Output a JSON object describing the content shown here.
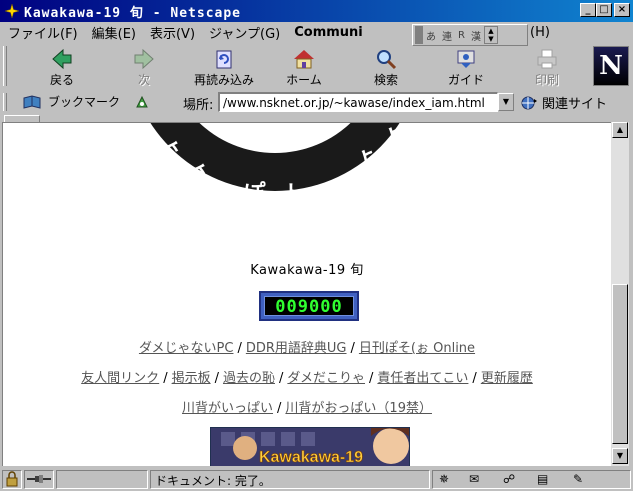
{
  "window": {
    "title": "Kawakawa-19 旬 - Netscape"
  },
  "menu": {
    "items": [
      "ファイル(F)",
      "編集(E)",
      "表示(V)",
      "ジャンプ(G)",
      "Communi"
    ],
    "last": "(H)"
  },
  "ime": {
    "cells": [
      "あ",
      "連",
      "R",
      "漢"
    ]
  },
  "toolbar": {
    "back": "戻る",
    "forward": "次",
    "reload": "再読み込み",
    "home": "ホーム",
    "search": "検索",
    "guide": "ガイド",
    "print": "印刷",
    "logo": "N"
  },
  "location": {
    "bookmarks": "ブックマーク",
    "label": "場所:",
    "url": "/www.nsknet.or.jp/~kawase/index_iam.html",
    "related": "関連サイト"
  },
  "page": {
    "emblem_text": "ト に ぁ ぽ ト ホ に ぁ",
    "title": "Kawakawa-19 旬",
    "counter": "009000",
    "links_row1": [
      "ダメじゃないPC",
      "DDR用語辞典UG",
      "日刊ぽそ(ぉ Online"
    ],
    "links_row2": [
      "友人間リンク",
      "掲示板",
      "過去の恥",
      "ダメだこりゃ",
      "責任者出てこい",
      "更新履歴"
    ],
    "links_row3": [
      "川背がいっぱい",
      "川背がおっぱい（19禁）"
    ],
    "separator": "/",
    "banner_text": "Kawakawa-19"
  },
  "status": {
    "text": "ドキュメント: 完了。"
  },
  "colors": {
    "titlebar": "#000080",
    "counter_digits": "#30ff30",
    "link": "#555555"
  }
}
